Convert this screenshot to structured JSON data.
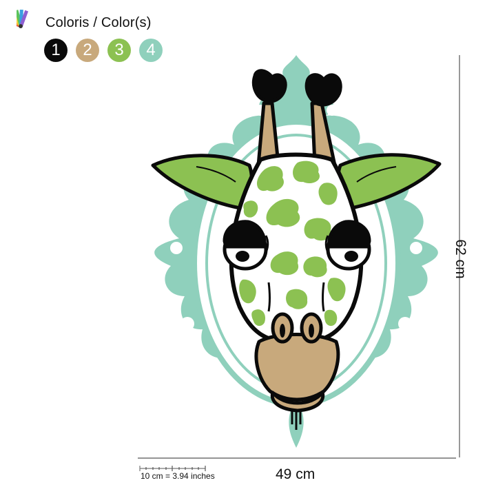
{
  "header": {
    "title": "Coloris / Color(s)",
    "palette_icon": "color-fan-icon"
  },
  "colors": [
    {
      "label": "1",
      "hex": "#0a0a0a"
    },
    {
      "label": "2",
      "hex": "#c8a97c"
    },
    {
      "label": "3",
      "hex": "#8cc152"
    },
    {
      "label": "4",
      "hex": "#8fd0bc"
    }
  ],
  "dimensions": {
    "height": "62 cm",
    "width": "49 cm",
    "scale": "10 cm = 3.94 inches"
  }
}
